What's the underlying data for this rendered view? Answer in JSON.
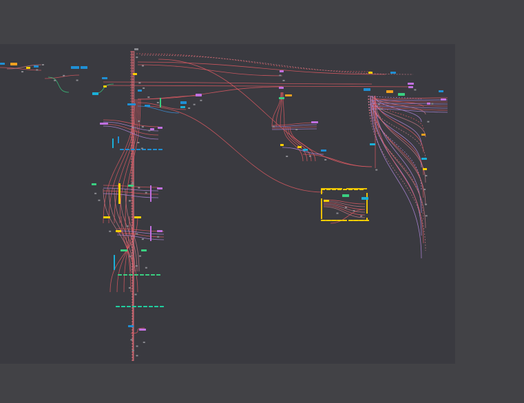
{
  "canvas": {
    "background_color": "#424246",
    "graph_background_color": "#3a3a40",
    "wire_colors": {
      "primary": "#e05a63",
      "secondary": "#c97a86",
      "tertiary": "#b48ae0",
      "accent_blue": "#3b8fd8",
      "accent_green": "#3ad081"
    },
    "node_colors": {
      "blue": "#1f8fd4",
      "cyan": "#1ab0d8",
      "orange": "#f0a020",
      "yellow": "#ffd000",
      "green": "#3ad081",
      "purple": "#c070e0",
      "teal": "#20d0a0",
      "grey": "#8a8a90"
    },
    "frame_color": "#ffd000"
  }
}
